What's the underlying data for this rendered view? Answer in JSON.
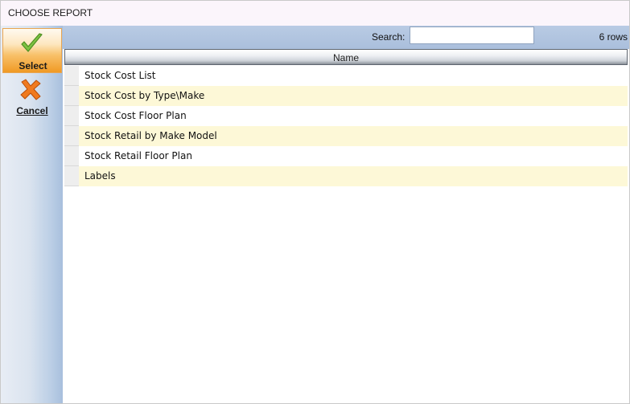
{
  "window": {
    "title": "CHOOSE REPORT"
  },
  "sidebar": {
    "select": {
      "label": "Select",
      "icon": "checkmark-icon"
    },
    "cancel": {
      "label": "Cancel",
      "icon": "close-x-icon"
    }
  },
  "toolbar": {
    "search_label": "Search:",
    "search_value": "",
    "row_count": "6 rows"
  },
  "grid": {
    "columns": [
      "Name"
    ],
    "rows": [
      {
        "name": "Stock Cost List"
      },
      {
        "name": "Stock Cost by Type\\Make"
      },
      {
        "name": "Stock Cost Floor Plan"
      },
      {
        "name": "Stock Retail by Make Model"
      },
      {
        "name": "Stock Retail Floor Plan"
      },
      {
        "name": "Labels"
      }
    ]
  },
  "colors": {
    "accent_select": "#f09a24",
    "row_alt": "#fdf8d7",
    "toolbar": "#b0c4df"
  }
}
